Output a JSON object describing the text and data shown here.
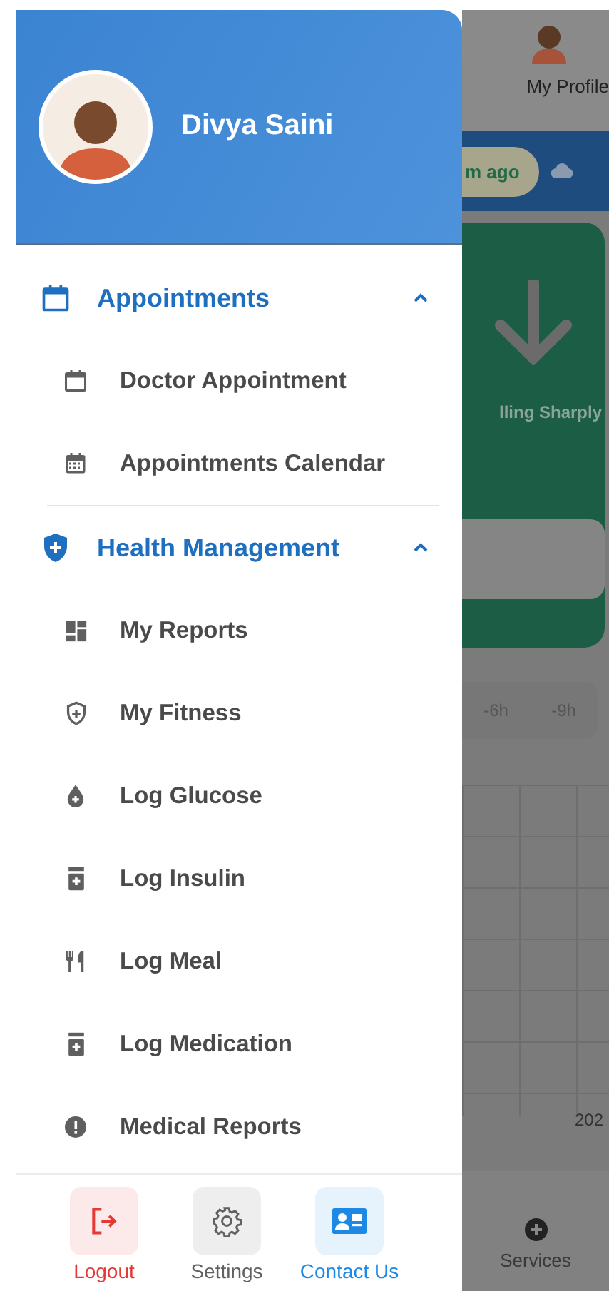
{
  "drawer": {
    "user_name": "Divya Saini",
    "sections": [
      {
        "title": "Appointments",
        "expanded": true,
        "children": [
          {
            "label": "Doctor Appointment"
          },
          {
            "label": "Appointments Calendar"
          }
        ]
      },
      {
        "title": "Health Management",
        "expanded": true,
        "children": [
          {
            "label": "My Reports"
          },
          {
            "label": "My Fitness"
          },
          {
            "label": "Log Glucose"
          },
          {
            "label": "Log Insulin"
          },
          {
            "label": "Log Meal"
          },
          {
            "label": "Log Medication"
          },
          {
            "label": "Medical Reports"
          }
        ]
      }
    ],
    "footer_actions": [
      {
        "label": "Logout",
        "color": "#e53935"
      },
      {
        "label": "Settings",
        "color": "#616161"
      },
      {
        "label": "Contact Us",
        "color": "#1e88e5"
      }
    ]
  },
  "background_screen": {
    "profile_label": "My Profile",
    "sync_pill": "m ago",
    "trend_text": "lling Sharply",
    "time_ranges": [
      "-6h",
      "-9h"
    ],
    "axis_label": "202",
    "nav_label": "Services"
  }
}
